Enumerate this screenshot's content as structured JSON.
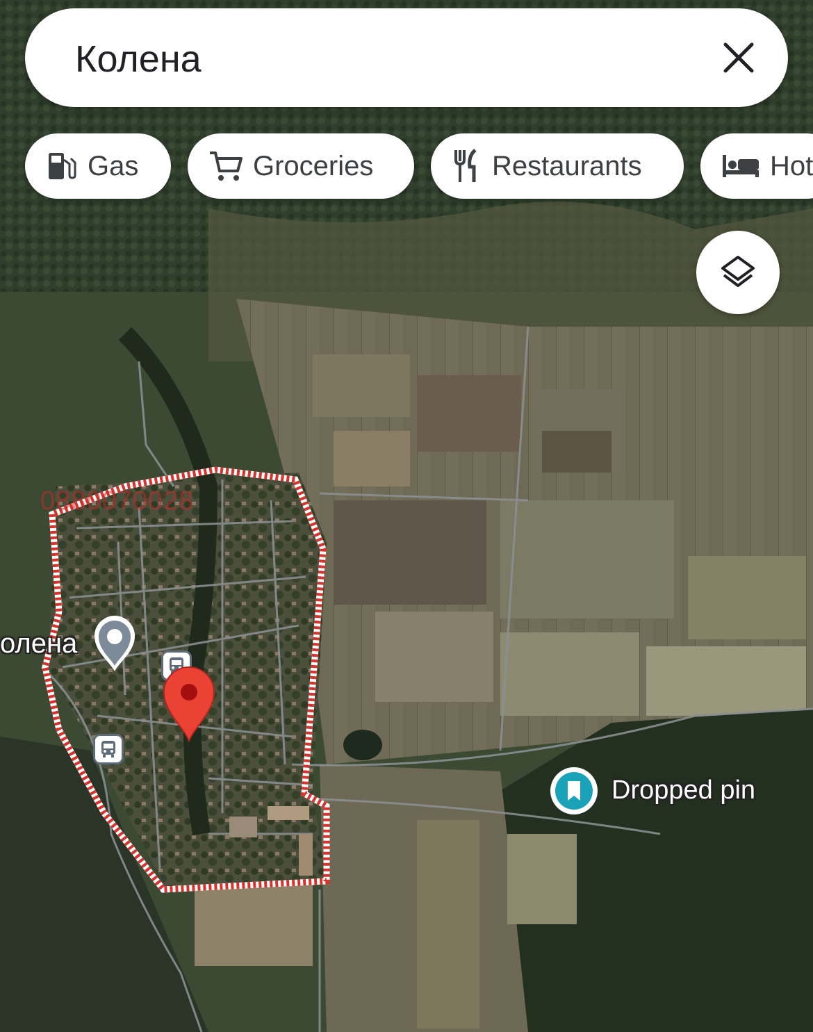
{
  "search": {
    "query": "Колена"
  },
  "chips": [
    {
      "label": "Gas",
      "icon": "gas-station-icon"
    },
    {
      "label": "Groceries",
      "icon": "shopping-cart-icon"
    },
    {
      "label": "Restaurants",
      "icon": "fork-knife-icon"
    },
    {
      "label": "Hot",
      "icon": "bed-icon"
    }
  ],
  "map": {
    "type": "satellite",
    "place_label": "олена",
    "watermark": "0880070028",
    "dropped_pin_label": "Dropped pin",
    "boundary_color": "#d7322c",
    "marker_color": "#ea4335"
  },
  "layers": {
    "icon": "layers-icon"
  }
}
